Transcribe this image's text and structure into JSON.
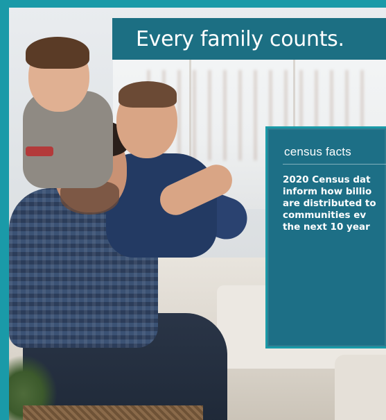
{
  "headline": {
    "text": "Every family counts."
  },
  "facts": {
    "label": "census facts",
    "body": "2020 Census dat\ninform how billio\nare distributed to\ncommunities ev\nthe next 10 year"
  },
  "colors": {
    "frame": "#1a9aa8",
    "banner": "#1c6f83",
    "facts_box": "#1d6f86",
    "text": "#ffffff"
  },
  "image": {
    "subject": "photo-family-on-sofa"
  }
}
